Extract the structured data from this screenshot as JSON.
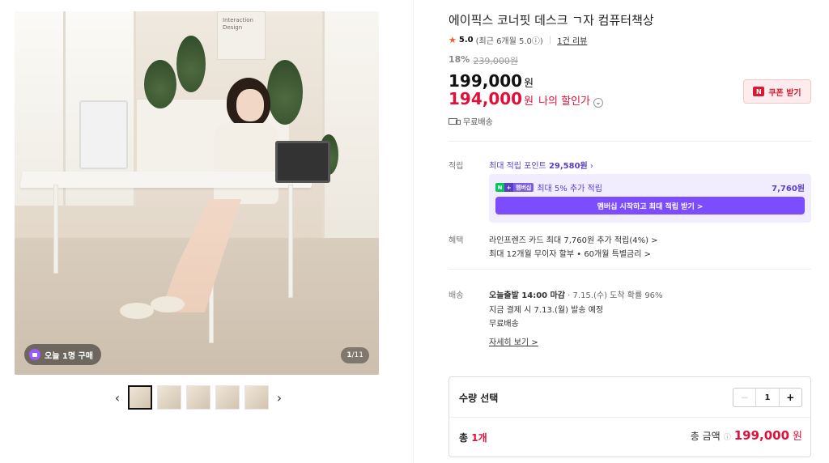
{
  "gallery": {
    "poster_text": "Interaction\nDesign",
    "today_badge": "오늘 1명 구매",
    "counter_current": "1",
    "counter_total": "/11",
    "thumbnails": 5
  },
  "product": {
    "title": "에이픽스 코너핏 데스크 ㄱ자 컴퓨터책상",
    "rating": "5.0",
    "rating_detail": "(최근 6개월 5.0ⓘ)",
    "review_link": "1건 리뷰",
    "discount_pct": "18%",
    "original_price": "239,000원",
    "price": "199,000",
    "price_unit": "원",
    "my_price": "194,000",
    "my_price_unit": "원",
    "my_price_label": "나의 할인가",
    "coupon_label": "쿠폰 받기",
    "coupon_icon_letter": "N",
    "shipping_free": "무료배송"
  },
  "points": {
    "label": "적립",
    "max_points_label": "최대 적립 포인트",
    "max_points_value": "29,580원",
    "member_badge_text": "멤버십",
    "member_extra": "최대 5% 추가 적립",
    "member_amount": "7,760원",
    "member_button": "멤버십 시작하고 최대 적립 받기 >"
  },
  "benefit": {
    "label": "혜택",
    "line1": "라인프렌즈 카드 최대 7,760원 추가 적립(4%) >",
    "line2": "최대 12개월 무이자 할부 • 60개월 특별금리 >"
  },
  "delivery": {
    "label": "배송",
    "line1_bold": "오늘출발 14:00 마감",
    "line1_rest": " · 7.15.(수) 도착 확률 96%",
    "line2": "지금 결제 시 7.13.(월) 발송 예정",
    "line3": "무료배송",
    "detail_link": "자세히 보기 >"
  },
  "order": {
    "qty_label": "수량 선택",
    "qty_value": "1",
    "minus": "−",
    "plus": "+",
    "total_prefix": "총 ",
    "total_count": "1개",
    "total_label": "총 금액",
    "total_info": "ⓘ",
    "total_amount": "199,000",
    "total_unit": "원"
  },
  "colors": {
    "accent_red": "#e0103a",
    "membership_purple": "#7c4dff",
    "star": "#f55a2c"
  }
}
